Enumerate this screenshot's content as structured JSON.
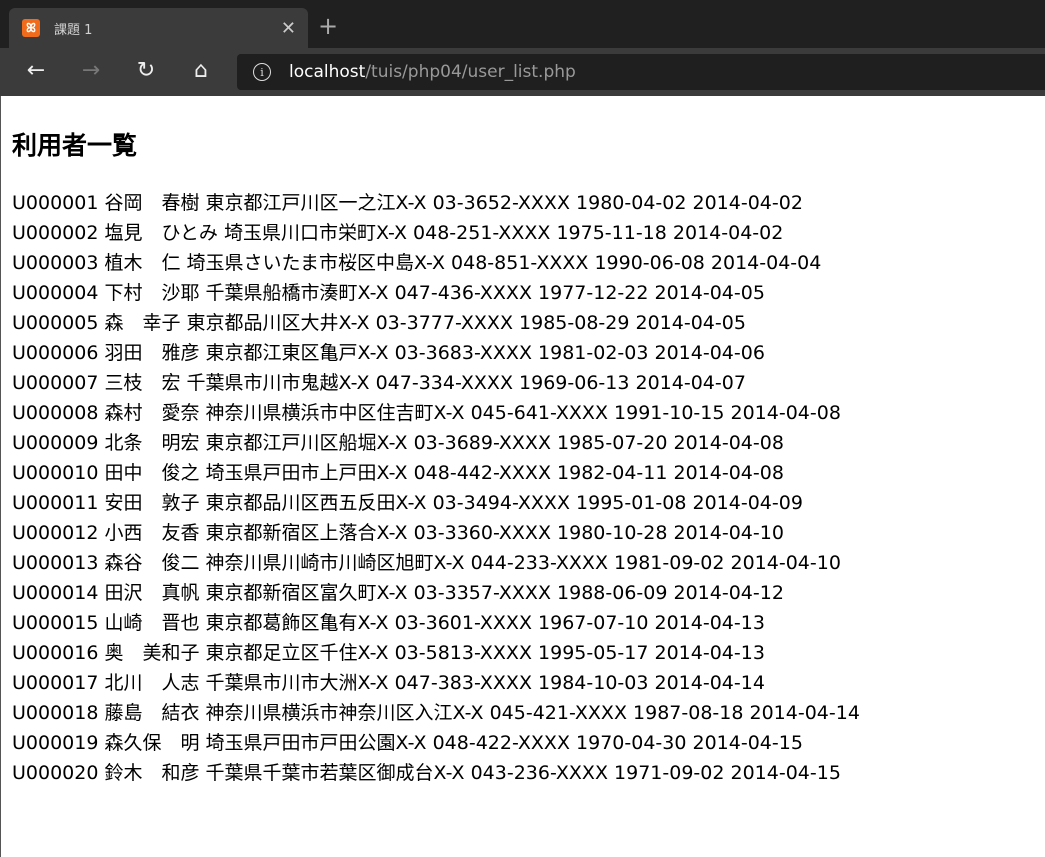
{
  "browser": {
    "tab_title": "課題 1",
    "favicon": "xampp-icon",
    "url_host": "localhost",
    "url_path": "/tuis/php04/user_list.php"
  },
  "page": {
    "heading": "利用者一覧"
  },
  "users": [
    [
      "U000001",
      "谷岡　春樹",
      "東京都江戸川区一之江X-X",
      "03-3652-XXXX",
      "1980-04-02",
      "2014-04-02"
    ],
    [
      "U000002",
      "塩見　ひとみ",
      "埼玉県川口市栄町X-X",
      "048-251-XXXX",
      "1975-11-18",
      "2014-04-02"
    ],
    [
      "U000003",
      "植木　仁",
      "埼玉県さいたま市桜区中島X-X",
      "048-851-XXXX",
      "1990-06-08",
      "2014-04-04"
    ],
    [
      "U000004",
      "下村　沙耶",
      "千葉県船橋市湊町X-X",
      "047-436-XXXX",
      "1977-12-22",
      "2014-04-05"
    ],
    [
      "U000005",
      "森　幸子",
      "東京都品川区大井X-X",
      "03-3777-XXXX",
      "1985-08-29",
      "2014-04-05"
    ],
    [
      "U000006",
      "羽田　雅彦",
      "東京都江東区亀戸X-X",
      "03-3683-XXXX",
      "1981-02-03",
      "2014-04-06"
    ],
    [
      "U000007",
      "三枝　宏",
      "千葉県市川市鬼越X-X",
      "047-334-XXXX",
      "1969-06-13",
      "2014-04-07"
    ],
    [
      "U000008",
      "森村　愛奈",
      "神奈川県横浜市中区住吉町X-X",
      "045-641-XXXX",
      "1991-10-15",
      "2014-04-08"
    ],
    [
      "U000009",
      "北条　明宏",
      "東京都江戸川区船堀X-X",
      "03-3689-XXXX",
      "1985-07-20",
      "2014-04-08"
    ],
    [
      "U000010",
      "田中　俊之",
      "埼玉県戸田市上戸田X-X",
      "048-442-XXXX",
      "1982-04-11",
      "2014-04-08"
    ],
    [
      "U000011",
      "安田　敦子",
      "東京都品川区西五反田X-X",
      "03-3494-XXXX",
      "1995-01-08",
      "2014-04-09"
    ],
    [
      "U000012",
      "小西　友香",
      "東京都新宿区上落合X-X",
      "03-3360-XXXX",
      "1980-10-28",
      "2014-04-10"
    ],
    [
      "U000013",
      "森谷　俊二",
      "神奈川県川崎市川崎区旭町X-X",
      "044-233-XXXX",
      "1981-09-02",
      "2014-04-10"
    ],
    [
      "U000014",
      "田沢　真帆",
      "東京都新宿区富久町X-X",
      "03-3357-XXXX",
      "1988-06-09",
      "2014-04-12"
    ],
    [
      "U000015",
      "山崎　晋也",
      "東京都葛飾区亀有X-X",
      "03-3601-XXXX",
      "1967-07-10",
      "2014-04-13"
    ],
    [
      "U000016",
      "奥　美和子",
      "東京都足立区千住X-X",
      "03-5813-XXXX",
      "1995-05-17",
      "2014-04-13"
    ],
    [
      "U000017",
      "北川　人志",
      "千葉県市川市大洲X-X",
      "047-383-XXXX",
      "1984-10-03",
      "2014-04-14"
    ],
    [
      "U000018",
      "藤島　結衣",
      "神奈川県横浜市神奈川区入江X-X",
      "045-421-XXXX",
      "1987-08-18",
      "2014-04-14"
    ],
    [
      "U000019",
      "森久保　明",
      "埼玉県戸田市戸田公園X-X",
      "048-422-XXXX",
      "1970-04-30",
      "2014-04-15"
    ],
    [
      "U000020",
      "鈴木　和彦",
      "千葉県千葉市若葉区御成台X-X",
      "043-236-XXXX",
      "1971-09-02",
      "2014-04-15"
    ]
  ]
}
